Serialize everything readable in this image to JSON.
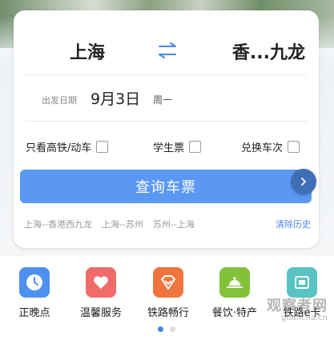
{
  "route": {
    "from": "上海",
    "to": "香...九龙"
  },
  "date": {
    "label": "出发日期",
    "value": "9月3日",
    "weekday": "周一"
  },
  "options": [
    {
      "label": "只看高铁/动车",
      "checked": false
    },
    {
      "label": "学生票",
      "checked": false
    },
    {
      "label": "兑换车次",
      "checked": false
    }
  ],
  "query_button": "查询车票",
  "history": [
    "上海--香港西九龙",
    "上海--苏州",
    "苏州--上海"
  ],
  "clear_history": "清除历史",
  "services": [
    {
      "label": "正晚点",
      "icon": "clock-icon",
      "color": "#4d90ee"
    },
    {
      "label": "温馨服务",
      "icon": "heart-icon",
      "color": "#f26b6b"
    },
    {
      "label": "铁路畅行",
      "icon": "diamond-icon",
      "color": "#f0753c"
    },
    {
      "label": "餐饮·特产",
      "icon": "food-cover-icon",
      "color": "#82c23a"
    },
    {
      "label": "铁路e卡",
      "icon": "card-icon",
      "color": "#57c4c3"
    }
  ],
  "pagination": {
    "current": 1,
    "total": 2
  },
  "watermark": {
    "text": "观察者网",
    "url": "guancha.cn"
  },
  "colors": {
    "primary": "#5b98f4",
    "accent": "#4a86e8"
  }
}
